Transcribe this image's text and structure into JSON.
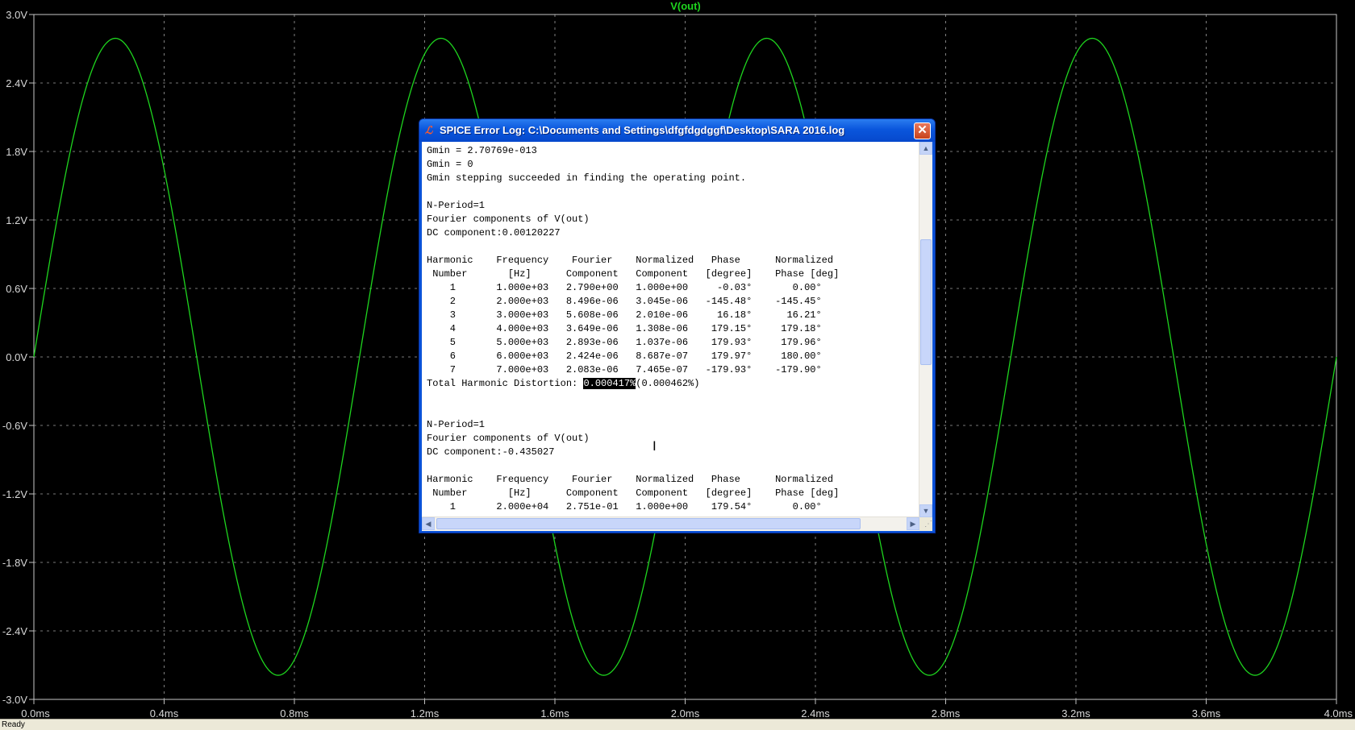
{
  "plot": {
    "trace_name": "V(out)",
    "trace_color": "#1ed51e",
    "background": "#000000",
    "grid_color": "#a0a0a0",
    "y_ticks": [
      "3.0V",
      "2.4V",
      "1.8V",
      "1.2V",
      "0.6V",
      "0.0V",
      "-0.6V",
      "-1.2V",
      "-1.8V",
      "-2.4V",
      "-3.0V"
    ],
    "x_ticks": [
      "0.0ms",
      "0.4ms",
      "0.8ms",
      "1.2ms",
      "1.6ms",
      "2.0ms",
      "2.4ms",
      "2.8ms",
      "3.2ms",
      "3.6ms",
      "4.0ms"
    ]
  },
  "chart_data": {
    "type": "line",
    "title": "V(out)",
    "xlabel": "",
    "ylabel": "",
    "xlim": [
      0,
      4.0
    ],
    "ylim": [
      -3.0,
      3.0
    ],
    "x_unit": "ms",
    "y_unit": "V",
    "grid": true,
    "series": [
      {
        "name": "V(out)",
        "amplitude": 2.79,
        "frequency_hz": 1000,
        "phase_deg": -0.03,
        "points": [
          [
            0,
            0
          ],
          [
            0.25,
            2.79
          ],
          [
            0.5,
            0
          ],
          [
            0.75,
            -2.79
          ],
          [
            1.0,
            0
          ],
          [
            1.25,
            2.79
          ],
          [
            1.5,
            0
          ],
          [
            1.75,
            -2.79
          ],
          [
            2.0,
            0
          ],
          [
            2.25,
            2.79
          ],
          [
            2.5,
            0
          ],
          [
            2.75,
            -2.79
          ],
          [
            3.0,
            0
          ],
          [
            3.25,
            2.79
          ],
          [
            3.5,
            0
          ],
          [
            3.75,
            -2.79
          ],
          [
            4.0,
            0
          ]
        ]
      }
    ]
  },
  "dialog": {
    "title": "SPICE Error Log: C:\\Documents and Settings\\dfgfdgdggf\\Desktop\\SARA 2016.log",
    "close_label": "✕",
    "lines": [
      "Gmin = 2.70769e-013",
      "Gmin = 0",
      "Gmin stepping succeeded in finding the operating point.",
      "",
      "N-Period=1",
      "Fourier components of V(out)",
      "DC component:0.00120227",
      "",
      "Harmonic    Frequency    Fourier    Normalized   Phase      Normalized",
      " Number       [Hz]      Component   Component   [degree]    Phase [deg]",
      "    1       1.000e+03   2.790e+00   1.000e+00     -0.03°       0.00°",
      "    2       2.000e+03   8.496e-06   3.045e-06   -145.48°    -145.45°",
      "    3       3.000e+03   5.608e-06   2.010e-06     16.18°      16.21°",
      "    4       4.000e+03   3.649e-06   1.308e-06    179.15°     179.18°",
      "    5       5.000e+03   2.893e-06   1.037e-06    179.93°     179.96°",
      "    6       6.000e+03   2.424e-06   8.687e-07    179.97°     180.00°",
      "    7       7.000e+03   2.083e-06   7.465e-07   -179.93°    -179.90°"
    ],
    "thd_prefix": "Total Harmonic Distortion: ",
    "thd_selected": "0.000417%",
    "thd_suffix": "(0.000462%)",
    "lines_after": [
      "",
      "",
      "N-Period=1",
      "Fourier components of V(out)",
      "DC component:-0.435027",
      "",
      "Harmonic    Frequency    Fourier    Normalized   Phase      Normalized",
      " Number       [Hz]      Component   Component   [degree]    Phase [deg]",
      "    1       2.000e+04   2.751e-01   1.000e+00    179.54°       0.00°"
    ]
  },
  "status": {
    "text": "Ready"
  },
  "icons": {
    "app": "ltspice-icon",
    "close": "close-icon",
    "scroll_up": "scroll-up-icon",
    "scroll_down": "scroll-down-icon",
    "scroll_left": "scroll-left-icon",
    "scroll_right": "scroll-right-icon"
  }
}
